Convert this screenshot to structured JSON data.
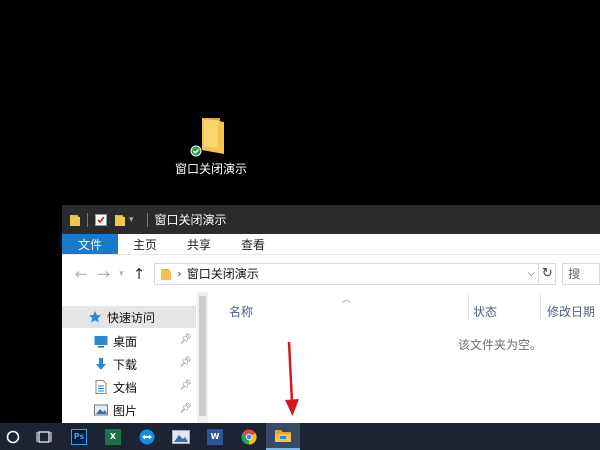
{
  "desktop": {
    "icon_label": "窗口关闭演示"
  },
  "window": {
    "title": "窗口关闭演示",
    "ribbon_tabs": [
      "文件",
      "主页",
      "共享",
      "查看"
    ],
    "address_path": "窗口关闭演示",
    "search_placeholder": "搜",
    "columns": [
      "名称",
      "状态",
      "修改日期"
    ],
    "empty_message": "该文件夹为空。",
    "nav_quick_access": "快速访问",
    "nav_items": [
      {
        "label": "桌面",
        "icon": "desktop-icon"
      },
      {
        "label": "下载",
        "icon": "download-icon"
      },
      {
        "label": "文档",
        "icon": "document-icon"
      },
      {
        "label": "图片",
        "icon": "picture-icon"
      }
    ]
  },
  "taskbar": {
    "apps": [
      {
        "name": "photoshop",
        "glyph": "Ps",
        "color": "#0b1a36"
      },
      {
        "name": "excel",
        "glyph": "X",
        "color": "#1e7145"
      },
      {
        "name": "teamviewer",
        "glyph": "↔",
        "color": "#0e8ee9"
      },
      {
        "name": "image-viewer",
        "glyph": "",
        "color": "#3a6ea5"
      },
      {
        "name": "word",
        "glyph": "W",
        "color": "#2b579a"
      },
      {
        "name": "chrome",
        "glyph": "",
        "color": "#dd4b39"
      },
      {
        "name": "file-explorer",
        "glyph": "",
        "color": "#f3c44c"
      }
    ]
  },
  "colors": {
    "accent": "#1979ca",
    "taskbar": "#1c2433",
    "folder": "#f3c44c",
    "annotation_arrow": "#d11a1a"
  }
}
